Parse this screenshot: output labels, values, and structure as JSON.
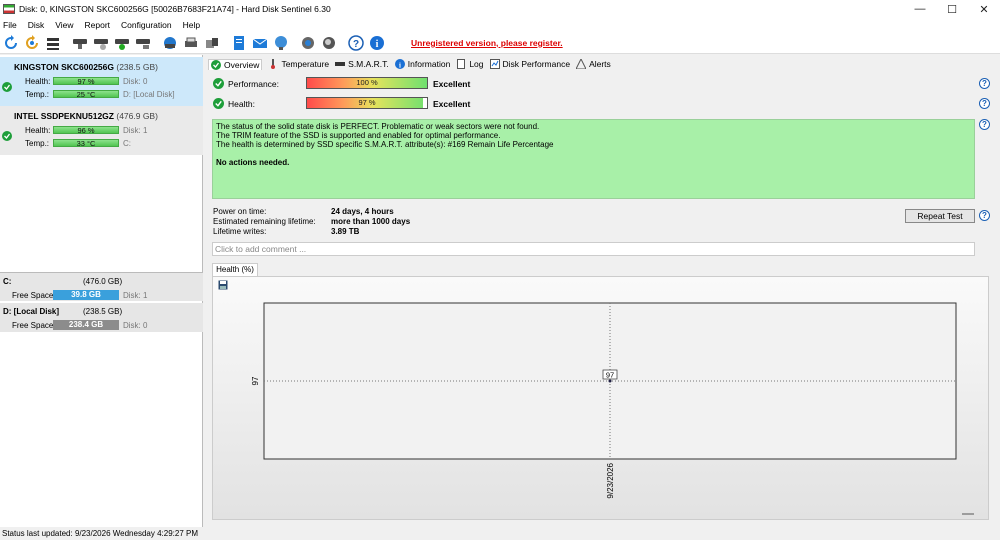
{
  "window": {
    "title": "Disk: 0, KINGSTON SKC600256G [50026B7683F21A74]  -  Hard Disk Sentinel 6.30"
  },
  "menu": [
    "File",
    "Disk",
    "View",
    "Report",
    "Configuration",
    "Help"
  ],
  "toolbar": {
    "unregistered": "Unregistered version, please register."
  },
  "disks": [
    {
      "name": "KINGSTON SKC600256G",
      "size": "(238.5 GB)",
      "health": "97 %",
      "health_extra": "Disk: 0",
      "temp": "25 °C",
      "temp_extra": "D: [Local Disk]",
      "health_label": "Health:",
      "temp_label": "Temp.:"
    },
    {
      "name": "INTEL SSDPEKNU512GZ",
      "size": "(476.9 GB)",
      "health": "96 %",
      "health_extra": "Disk: 1",
      "temp": "33 °C",
      "temp_extra": "C:",
      "health_label": "Health:",
      "temp_label": "Temp.:"
    }
  ],
  "volumes": [
    {
      "name": "C:",
      "size": "(476.0 GB)",
      "free_label": "Free Space",
      "free": "39.8 GB",
      "disk": "Disk: 1",
      "color": "#3aa0dc"
    },
    {
      "name": "D: [Local Disk]",
      "size": "(238.5 GB)",
      "free_label": "Free Space",
      "free": "238.4 GB",
      "disk": "Disk: 0",
      "color": "#8c8c8c"
    }
  ],
  "tabs": [
    "Overview",
    "Temperature",
    "S.M.A.R.T.",
    "Information",
    "Log",
    "Disk Performance",
    "Alerts"
  ],
  "overview": {
    "performance_label": "Performance:",
    "performance_value": "100 %",
    "performance_pct": 100,
    "performance_rating": "Excellent",
    "health_label": "Health:",
    "health_value": "97 %",
    "health_pct": 97,
    "health_rating": "Excellent",
    "status_lines": [
      "The status of the solid state disk is PERFECT. Problematic or weak sectors were not found.",
      "The TRIM feature of the SSD is supported and enabled for optimal performance.",
      "The health is determined by SSD specific S.M.A.R.T. attribute(s):  #169 Remain Life Percentage"
    ],
    "no_actions": "No actions needed.",
    "power_on_label": "Power on time:",
    "power_on_value": "24 days, 4 hours",
    "lifetime_label": "Estimated remaining lifetime:",
    "lifetime_value": "more than 1000 days",
    "writes_label": "Lifetime writes:",
    "writes_value": "3.89 TB",
    "repeat_test": "Repeat Test",
    "comment_placeholder": "Click to add comment ...",
    "chart_tab": "Health (%)"
  },
  "chart_data": {
    "type": "line",
    "x": [
      "9/23/2026"
    ],
    "series": [
      {
        "values": [
          97
        ]
      }
    ],
    "ylabel": "",
    "y_tick_labels": [
      "97"
    ],
    "x_tick_labels": [
      "9/23/2026"
    ],
    "data_labels": [
      "97"
    ],
    "grid": true
  },
  "statusbar": "Status last updated: 9/23/2026 Wednesday 4:29:27 PM"
}
